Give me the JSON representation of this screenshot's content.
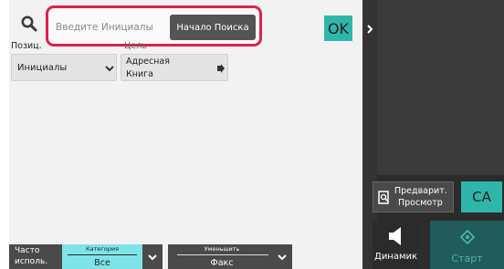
{
  "search": {
    "placeholder": "Введите Инициалы",
    "start_label": "Начало Поиска"
  },
  "ok_label": "OK",
  "fields": {
    "position_label": "Позиц.",
    "target_label": "Цель",
    "position_value": "Инициалы",
    "target_value_line1": "Адресная",
    "target_value_line2": "Книга"
  },
  "bottom": {
    "frequent_line1": "Часто",
    "frequent_line2": "исполь.",
    "category_caption": "Категория",
    "category_value": "Все",
    "reduce_caption": "Уменьшить",
    "reduce_value": "Факс"
  },
  "right": {
    "preview_line1": "Предварит.",
    "preview_line2": "Просмотр",
    "ca_label": "CA",
    "speaker_label": "Динамик",
    "start_label": "Старт"
  },
  "colors": {
    "accent": "#2fb6ab",
    "highlight": "#e0204c",
    "category_tab": "#7fe3ea",
    "dark_tab": "#4a4a4a",
    "field_bg": "#e4e4e4"
  }
}
